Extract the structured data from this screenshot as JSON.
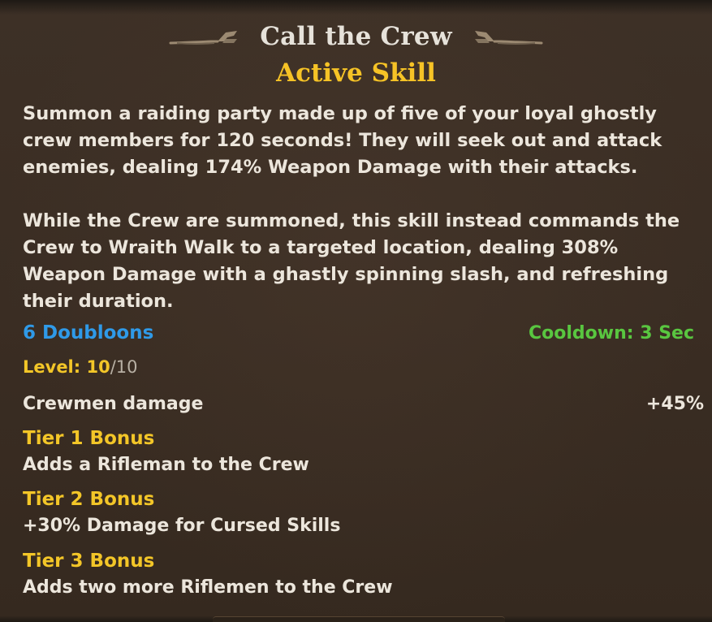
{
  "skill": {
    "name": "Call the Crew",
    "type": "Active Skill",
    "description_1": "Summon a raiding party made up of five of your loyal ghostly crew members for 120 seconds! They will seek out and attack enemies, dealing 174% Weapon Damage with their attacks.",
    "description_2": "While the Crew are summoned, this skill instead commands the Crew to Wraith Walk to a targeted location, dealing 308% Weapon Damage with a ghastly spinning slash, and refreshing their duration.",
    "cost": "6 Doubloons",
    "cooldown": "Cooldown: 3 Sec",
    "level_label": "Level: ",
    "level_current": "10",
    "level_max": "/10",
    "stat": {
      "name": "Crewmen damage",
      "value": "+45%"
    },
    "tiers": [
      {
        "title": "Tier 1 Bonus",
        "description": "Adds a Rifleman to the Crew"
      },
      {
        "title": "Tier 2 Bonus",
        "description": "+30% Damage for Cursed Skills"
      },
      {
        "title": "Tier 3 Bonus",
        "description": "Adds two more Riflemen to the Crew"
      }
    ]
  },
  "colors": {
    "title": "#e6e2da",
    "subtitle": "#f6c326",
    "cost": "#2f9ae8",
    "cooldown": "#59c640",
    "tier_title": "#f3c628",
    "background": "#3a2d23"
  },
  "icons": {
    "title_left": "ornament-flourish-left-icon",
    "title_right": "ornament-flourish-right-icon"
  }
}
